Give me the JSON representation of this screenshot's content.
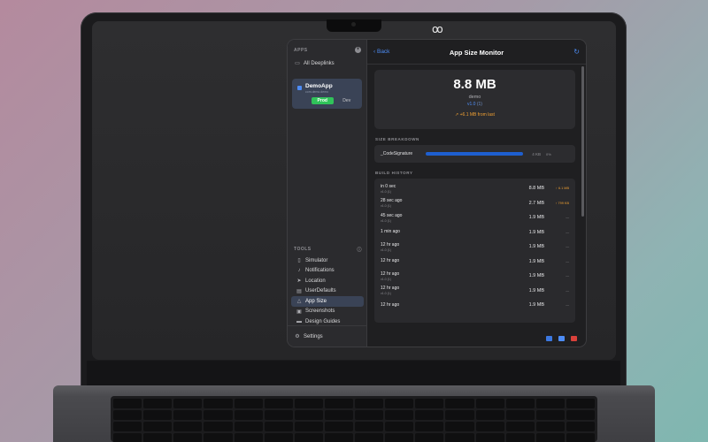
{
  "menubar": {
    "icon": "chain-link-icon",
    "glyph": "oo"
  },
  "sidebar": {
    "section_title": "APPS",
    "add_icon": "plus-icon",
    "items": [
      {
        "label": "All Deeplinks",
        "icon": "tray-icon"
      }
    ],
    "app_card": {
      "name": "DemoApp",
      "subtitle": "com.demo.demo",
      "env_prod": "Prod",
      "env_dev": "Dev"
    },
    "tools_title": "TOOLS",
    "tools": [
      {
        "label": "Simulator",
        "icon": "device-icon"
      },
      {
        "label": "Notifications",
        "icon": "bell-icon"
      },
      {
        "label": "Location",
        "icon": "location-arrow-icon"
      },
      {
        "label": "UserDefaults",
        "icon": "cabinet-icon"
      },
      {
        "label": "App Size",
        "icon": "weight-icon",
        "active": true
      },
      {
        "label": "Screenshots",
        "icon": "camera-icon"
      },
      {
        "label": "Design Guides",
        "icon": "ruler-icon"
      }
    ],
    "settings_label": "Settings"
  },
  "main": {
    "back_label": "Back",
    "title": "App Size Monitor",
    "hero": {
      "size": "8.8 MB",
      "app_name": "demo",
      "version": "v1.0",
      "build": "(1)",
      "delta": "↗ +6.1 MB from last"
    },
    "breakdown_title": "SIZE BREAKDOWN",
    "breakdown": [
      {
        "name": "_CodeSignature",
        "size": "4 KB",
        "pct": "0%"
      }
    ],
    "history_title": "BUILD HISTORY",
    "history": [
      {
        "time": "in 0 sec",
        "version": "v1.0 (1)",
        "size": "8.8 MB",
        "delta": "↑ 6.1 MB",
        "up": true
      },
      {
        "time": "28 sec ago",
        "version": "v1.0 (1)",
        "size": "2.7 MB",
        "delta": "↑ 799 KB",
        "up": true
      },
      {
        "time": "45 sec ago",
        "version": "v1.0 (1)",
        "size": "1.9 MB",
        "delta": "—",
        "up": false
      },
      {
        "time": "1 min ago",
        "version": "",
        "size": "1.9 MB",
        "delta": "—",
        "up": false
      },
      {
        "time": "12 hr ago",
        "version": "v1.0 (1)",
        "size": "1.9 MB",
        "delta": "—",
        "up": false
      },
      {
        "time": "12 hr ago",
        "version": "",
        "size": "1.9 MB",
        "delta": "—",
        "up": false
      },
      {
        "time": "12 hr ago",
        "version": "v1.0 (1)",
        "size": "1.9 MB",
        "delta": "—",
        "up": false
      },
      {
        "time": "12 hr ago",
        "version": "v1.0 (1)",
        "size": "1.9 MB",
        "delta": "—",
        "up": false
      },
      {
        "time": "12 hr ago",
        "version": "",
        "size": "1.9 MB",
        "delta": "—",
        "up": false
      }
    ],
    "footer_icons": [
      "folder-icon",
      "copy-icon",
      "trash-icon"
    ]
  },
  "colors": {
    "accent": "#4d8cf5",
    "prod": "#30c35a",
    "warning": "#f0a032",
    "danger": "#d9413b"
  }
}
